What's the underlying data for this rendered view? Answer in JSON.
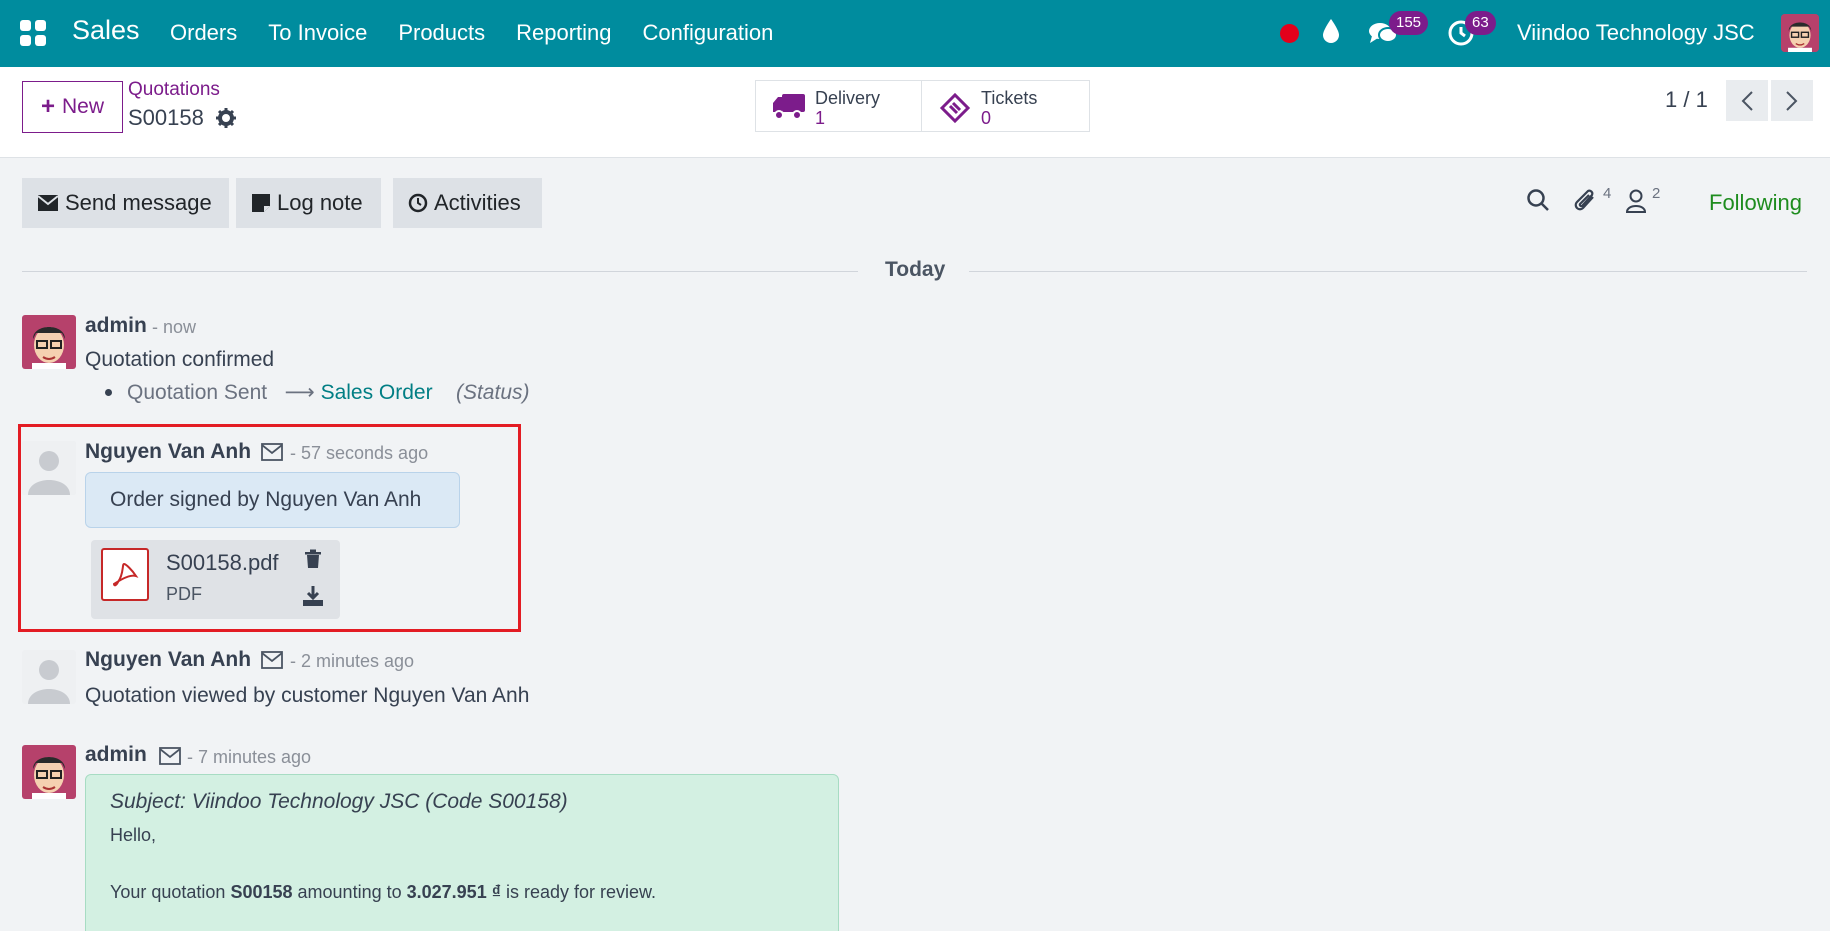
{
  "navbar": {
    "brand": "Sales",
    "menu": [
      "Orders",
      "To Invoice",
      "Products",
      "Reporting",
      "Configuration"
    ],
    "chat_count": "155",
    "activity_count": "63",
    "company": "Viindoo Technology JSC",
    "color": "#008c9e"
  },
  "control": {
    "new_label": "New",
    "breadcrumb_parent": "Quotations",
    "breadcrumb_current": "S00158",
    "smart_buttons": [
      {
        "label": "Delivery",
        "value": "1",
        "icon": "truck-icon"
      },
      {
        "label": "Tickets",
        "value": "0",
        "icon": "ticket-icon"
      }
    ],
    "pager": "1 / 1"
  },
  "chatter": {
    "send_message": "Send message",
    "log_note": "Log note",
    "activities": "Activities",
    "attachments_count": "4",
    "followers_count": "2",
    "following": "Following",
    "date_separator": "Today",
    "messages": [
      {
        "author": "admin",
        "meta": "- now",
        "body": "Quotation confirmed",
        "tracking": {
          "old": "Quotation Sent",
          "new": "Sales Order",
          "field": "(Status)"
        }
      },
      {
        "author": "Nguyen Van Anh",
        "meta": "- 57 seconds ago",
        "body": "Order signed by Nguyen Van Anh",
        "attachment": {
          "name": "S00158.pdf",
          "type": "PDF"
        }
      },
      {
        "author": "Nguyen Van Anh",
        "meta": "- 2 minutes ago",
        "body": "Quotation viewed by customer Nguyen Van Anh"
      },
      {
        "author": "admin",
        "meta": "- 7 minutes ago",
        "subject": "Subject: Viindoo Technology JSC (Code S00158)",
        "greeting": "Hello,",
        "line_prefix": "Your quotation",
        "line_code": "S00158",
        "line_mid": "amounting to",
        "line_amount": "3.027.951 ₫",
        "line_suffix": "is ready for review."
      }
    ]
  }
}
